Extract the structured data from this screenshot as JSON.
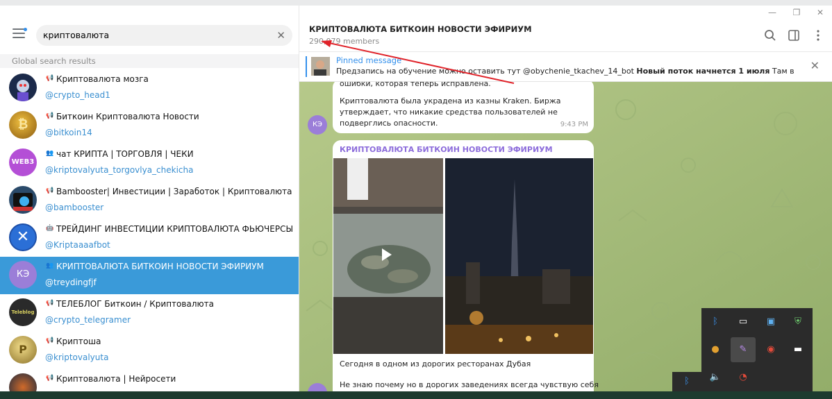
{
  "window": {
    "min": "—",
    "max": "❐",
    "close": "✕"
  },
  "search": {
    "value": "криптовалюта",
    "clear": "✕"
  },
  "left_section_label": "Global search results",
  "results": [
    {
      "kind": "📢",
      "name": "Криптовалюта мозга",
      "handle": "@crypto_head1",
      "avatar_color": "#1b2a4a",
      "avatar_text": ""
    },
    {
      "kind": "📢",
      "name": "Биткоин Криптовалюта Новости",
      "handle": "@bitkoin14",
      "avatar_color": "#c28b1c",
      "avatar_text": "₿"
    },
    {
      "kind": "👥",
      "name": "чат КРИПТА | ТОРГОВЛЯ | ЧЕКИ",
      "handle": "@kriptovalyuta_torgovlya_chekicha",
      "avatar_color": "#b44fd6",
      "avatar_text": "WEB3"
    },
    {
      "kind": "📢",
      "name": "Bambooster| Инвестиции | Заработок | Криптовалюта",
      "handle": "@bambooster",
      "avatar_color": "#2a4a6a",
      "avatar_text": ""
    },
    {
      "kind": "🤖",
      "name": "ТРЕЙДИНГ ИНВЕСТИЦИИ КРИПТОВАЛЮТА ФЬЮЧЕРСЫ",
      "handle": "@Kriptaaaafbot",
      "avatar_color": "#2b6fd6",
      "avatar_text": "✕"
    },
    {
      "kind": "👥",
      "name": "КРИПТОВАЛЮТА БИТКОИН НОВОСТИ ЭФИРИУМ",
      "handle": "@treydingfjf",
      "avatar_color": "#9b7ed8",
      "avatar_text": "КЭ",
      "active": true
    },
    {
      "kind": "📢",
      "name": "ТЕЛЕБЛОГ Биткоин / Криптовалюта",
      "handle": "@crypto_telegramer",
      "avatar_color": "#2a2a2a",
      "avatar_text": "Teleblog"
    },
    {
      "kind": "📢",
      "name": "Криптоша",
      "handle": "@kriptovalyuta",
      "avatar_color": "#c9a64a",
      "avatar_text": "P"
    },
    {
      "kind": "📢",
      "name": "Криптовалюта | Нейросети",
      "handle": "",
      "avatar_color": "#3a3a5a",
      "avatar_text": ""
    }
  ],
  "chat": {
    "title": "КРИПТОВАЛЮТА БИТКОИН НОВОСТИ ЭФИРИУМ",
    "members": "290,079 members",
    "pinned_label": "Pinned message",
    "pinned_text_plain": "Предзапись на обучение можно оставить тут  @obychenie_tkachev_14_bot ",
    "pinned_text_bold": "Новый поток начнется 1 июля",
    "pinned_text_tail": "  Там все оп...",
    "msg1_line1": "ошибки, которая теперь исправлена.",
    "msg1_body": "Криптовалюта была украдена из казны Kraken. Биржа утверждает, что никакие средства пользователей не подверглись опасности.",
    "msg1_time": "9:43 PM",
    "avatar_initials": "КЭ",
    "msg2_sender": "КРИПТОВАЛЮТА БИТКОИН НОВОСТИ ЭФИРИУМ",
    "msg2_caption1": "Сегодня в одном из дорогих ресторанах Дубая",
    "msg2_caption2": "Не знаю почему но в дорогих заведениях всегда чувствую себя"
  },
  "colors": {
    "accent": "#3390ec",
    "active_row": "#3a9ad9",
    "chat_bg": "#a7bd7e",
    "sender": "#8c6cdb",
    "arrow": "#e0232a"
  }
}
